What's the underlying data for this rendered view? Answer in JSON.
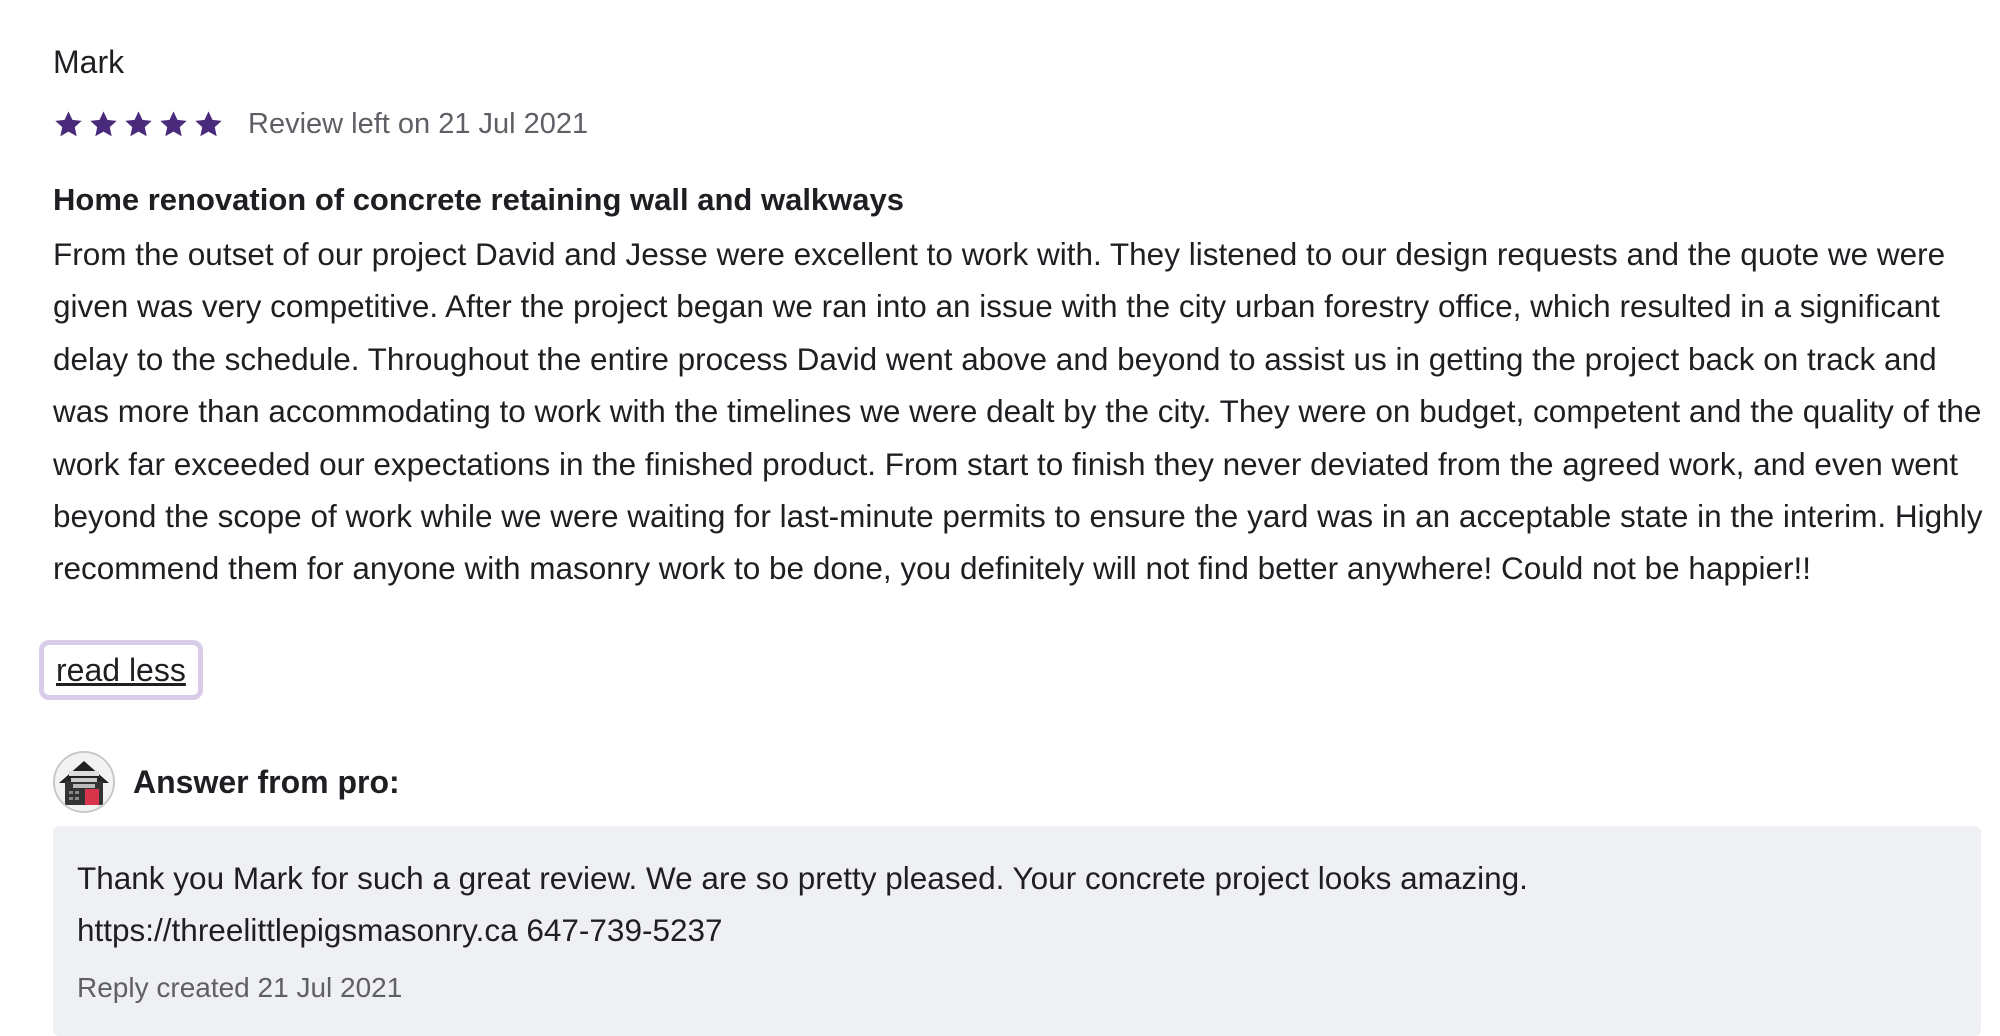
{
  "review": {
    "reviewer_name": "Mark",
    "rating": 5,
    "max_rating": 5,
    "star_color": "#4a2a7a",
    "date_text": "Review left on 21 Jul 2021",
    "title": "Home renovation of concrete retaining wall and walkways",
    "body": "From the outset of our project David and Jesse were excellent to work with. They listened to our design requests and the quote we were given was very competitive. After the project began we ran into an issue with the city urban forestry office, which resulted in a significant delay to the schedule. Throughout the entire process David went above and beyond to assist us in getting the project back on track and was more than accommodating to work with the timelines we were dealt by the city. They were on budget, competent and the quality of the work far exceeded our expectations in the finished product. From start to finish they never deviated from the agreed work, and even went beyond the scope of work while we were waiting for last-minute permits to ensure the yard was in an acceptable state in the interim. Highly recommend them for anyone with masonry work to be done, you definitely will not find better anywhere! Could not be happier!!",
    "read_less_label": "read less"
  },
  "answer": {
    "avatar_icon": "business-logo-avatar",
    "label": "Answer from pro:",
    "text": "Thank you Mark for such a great review. We are so pretty pleased. Your concrete project looks amazing.\nhttps://threelittlepigsmasonry.ca 647-739-5237",
    "reply_meta": "Reply created 21 Jul 2021"
  }
}
